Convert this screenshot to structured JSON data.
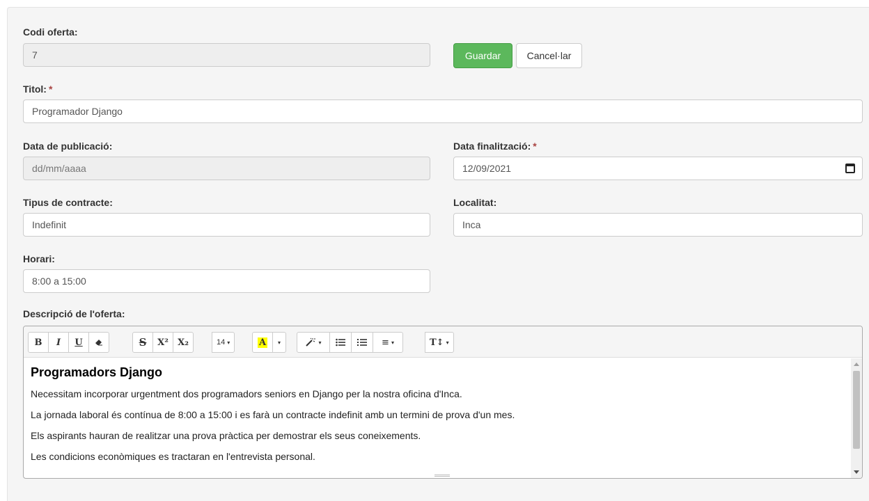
{
  "form": {
    "codi": {
      "label": "Codi oferta:",
      "value": "7"
    },
    "save_label": "Guardar",
    "cancel_label": "Cancel·lar",
    "titol": {
      "label": "Titol:",
      "value": "Programador Django"
    },
    "data_publicacio": {
      "label": "Data de publicació:",
      "placeholder": "dd/mm/aaaa"
    },
    "data_finalitzacio": {
      "label": "Data finalització:",
      "value": "12/09/2021"
    },
    "tipus_contracte": {
      "label": "Tipus de contracte:",
      "value": "Indefinit"
    },
    "localitat": {
      "label": "Localitat:",
      "value": "Inca"
    },
    "horari": {
      "label": "Horari:",
      "value": "8:00 a 15:00"
    },
    "descripcio": {
      "label": "Descripció de l'oferta:"
    },
    "required_mark": "*"
  },
  "editor": {
    "toolbar": {
      "bold": "B",
      "italic": "I",
      "underline": "U",
      "eraser": "eraser-icon",
      "strike": "S",
      "superscript": "X²",
      "subscript": "X₂",
      "font_size": "14",
      "color": "A",
      "caret": "▾",
      "magic": "magic-icon",
      "ul": "list-ul-icon",
      "ol": "list-ol-icon",
      "align": "≡",
      "height": "T↕"
    },
    "content": {
      "heading": "Programadors Django",
      "paragraphs": [
        "Necessitam incorporar urgentment dos programadors seniors en Django per la nostra oficina d'Inca.",
        "La jornada laboral és contínua de 8:00 a 15:00 i es farà un contracte indefinit amb un termini de prova d'un mes.",
        "Els aspirants hauran de realitzar una prova pràctica per demostrar els seus coneixements.",
        "Les condicions econòmiques es tractaran en l'entrevista personal."
      ]
    }
  },
  "colors": {
    "success": "#5cb85c",
    "required": "#a94442",
    "disabled_bg": "#eeeeee"
  }
}
